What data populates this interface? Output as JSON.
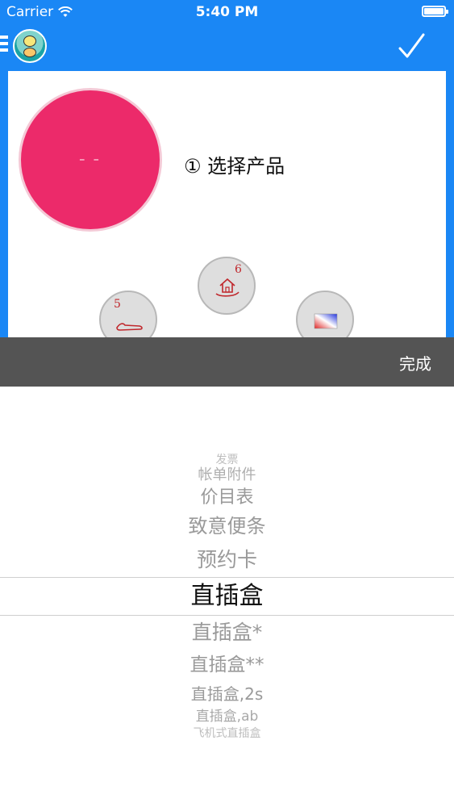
{
  "status_bar": {
    "carrier": "Carrier",
    "time": "5:40 PM"
  },
  "navbar": {
    "menu_icon": "hamburger-menu-icon",
    "logo_icon": "app-logo-icon",
    "confirm_icon": "checkmark-icon"
  },
  "canvas": {
    "main_node_label": "– –",
    "main_node_color": "#ec2a6a",
    "step_label": "① 选择产品",
    "nodes": [
      {
        "icon": "hand-icon",
        "badge": "5"
      },
      {
        "icon": "house-in-hand-icon",
        "badge": "6"
      },
      {
        "icon": "gradient-card-icon",
        "badge": ""
      }
    ]
  },
  "toolbar": {
    "done_label": "完成"
  },
  "picker": {
    "items": [
      "发票",
      "帐单附件",
      "价目表",
      "致意便条",
      "预约卡",
      "直插盒",
      "直插盒*",
      "直插盒**",
      "直插盒,2s",
      "直插盒,ab",
      "飞机式直插盒"
    ],
    "selected_index": 5
  },
  "colors": {
    "header_blue": "#1a87f5",
    "toolbar_gray": "#545454"
  }
}
